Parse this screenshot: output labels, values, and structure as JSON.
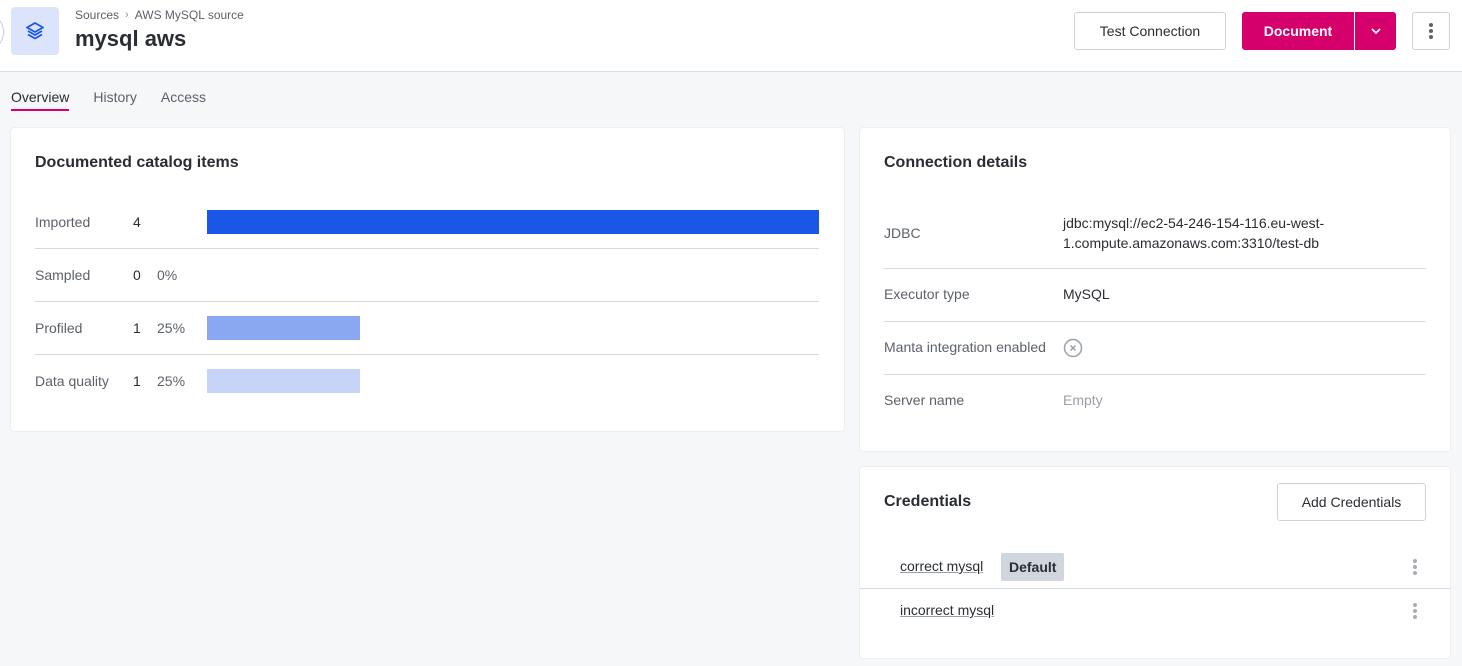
{
  "header": {
    "breadcrumb": [
      "Sources",
      "AWS MySQL source"
    ],
    "title": "mysql aws",
    "logo_icon": "layers-icon",
    "buttons": {
      "test_connection": "Test Connection",
      "document": "Document",
      "document_dropdown_icon": "chevron-down-icon",
      "more_icon": "kebab-vertical-icon"
    },
    "colors": {
      "accent": "#d6006c",
      "logo_bg": "#dce4fb",
      "logo_fg": "#1a57e6"
    }
  },
  "tabs": [
    {
      "label": "Overview",
      "active": true
    },
    {
      "label": "History",
      "active": false
    },
    {
      "label": "Access",
      "active": false
    }
  ],
  "catalog": {
    "title": "Documented catalog items",
    "rows": [
      {
        "label": "Imported",
        "count": "4",
        "percent": "",
        "fraction": 1.0,
        "color": "#1a57e6"
      },
      {
        "label": "Sampled",
        "count": "0",
        "percent": "0%",
        "fraction": 0.0,
        "color": "#1a57e6"
      },
      {
        "label": "Profiled",
        "count": "1",
        "percent": "25%",
        "fraction": 0.25,
        "color": "#8aa8f2"
      },
      {
        "label": "Data quality",
        "count": "1",
        "percent": "25%",
        "fraction": 0.25,
        "color": "#c5d4f7"
      }
    ]
  },
  "connection": {
    "title": "Connection details",
    "rows": [
      {
        "key": "JDBC",
        "value": "jdbc:mysql://ec2-54-246-154-116.eu-west-1.compute.amazonaws.com:3310/test-db"
      },
      {
        "key": "Executor type",
        "value": "MySQL"
      },
      {
        "key": "Manta integration enabled",
        "value_icon": "x-circle-icon"
      },
      {
        "key": "Server name",
        "value": "Empty"
      }
    ]
  },
  "credentials": {
    "title": "Credentials",
    "add_label": "Add Credentials",
    "items": [
      {
        "name": "correct mysql",
        "badge": "Default"
      },
      {
        "name": "incorrect mysql",
        "badge": ""
      }
    ]
  }
}
